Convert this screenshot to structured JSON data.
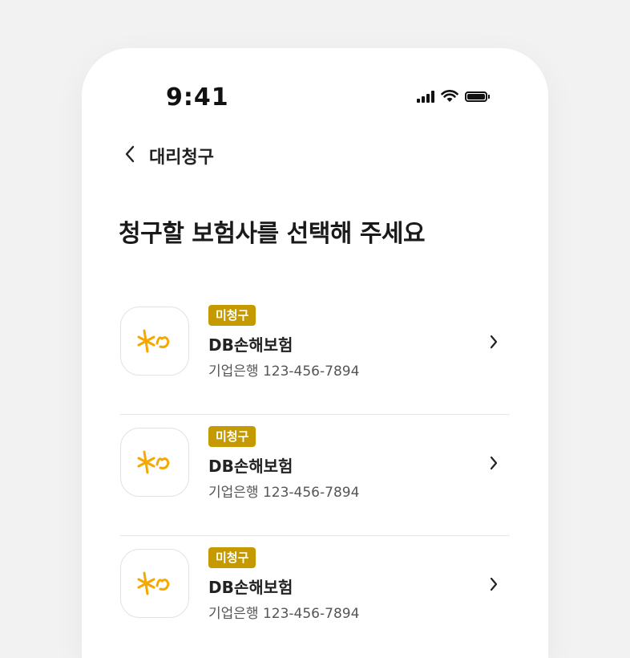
{
  "status_bar": {
    "time": "9:41",
    "icons": [
      "cellular-signal-icon",
      "wifi-icon",
      "battery-icon"
    ]
  },
  "nav": {
    "back_icon": "chevron-left-icon",
    "title": "대리청구"
  },
  "heading": "청구할 보험사를 선택해 주세요",
  "colors": {
    "badge": "#c49a00",
    "logo_accent": "#f5a800",
    "background": "#f2f2f2"
  },
  "insurers": [
    {
      "badge": "미청구",
      "name": "DB손해보험",
      "account": "기업은행 123-456-7894",
      "logo_icon": "kb-logo-icon"
    },
    {
      "badge": "미청구",
      "name": "DB손해보험",
      "account": "기업은행 123-456-7894",
      "logo_icon": "kb-logo-icon"
    },
    {
      "badge": "미청구",
      "name": "DB손해보험",
      "account": "기업은행 123-456-7894",
      "logo_icon": "kb-logo-icon"
    }
  ]
}
